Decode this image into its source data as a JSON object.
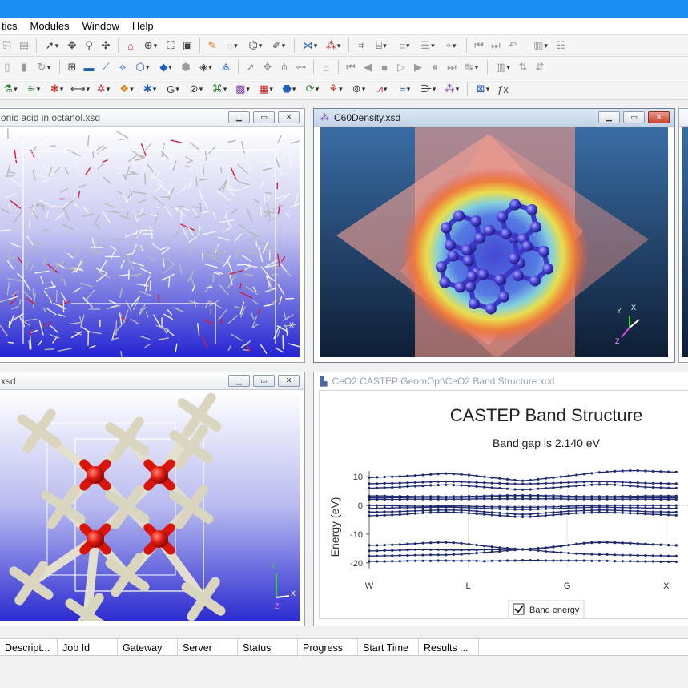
{
  "menu": [
    "tics",
    "Modules",
    "Window",
    "Help"
  ],
  "windows": {
    "octanol": {
      "title": "onic acid in octanol.xsd"
    },
    "c60": {
      "title": "C60Density.xsd"
    },
    "ceo2_struct": {
      "title": "xsd"
    },
    "band": {
      "title": "CeO2 CASTEP GeomOpt\\CeO2 Band Structure.xcd"
    }
  },
  "axis_labels": {
    "x": "X",
    "y": "Y",
    "z": "Z"
  },
  "chart_data": {
    "type": "line",
    "title": "CASTEP Band Structure",
    "subtitle": "Band gap is 2.140 eV",
    "ylabel": "Energy (eV)",
    "xlabel": "",
    "ylim": [
      -22,
      12
    ],
    "yticks": [
      10,
      0,
      -10,
      -20
    ],
    "kpoints": [
      "W",
      "L",
      "G",
      "X"
    ],
    "x": [
      0,
      1,
      2,
      3,
      4,
      5,
      6,
      7,
      8,
      9,
      10,
      11,
      12,
      13,
      14,
      15,
      16,
      17,
      18,
      19,
      20,
      21,
      22,
      23,
      24,
      25,
      26,
      27,
      28,
      29,
      30,
      31,
      32,
      33,
      34,
      35,
      36,
      37,
      38,
      39,
      40
    ],
    "series": [
      {
        "values": [
          -19.5,
          -19.5,
          -19.5,
          -19.4,
          -19.4,
          -19.3,
          -19.3,
          -19.3,
          -19.3,
          -19.2,
          -19.2,
          -19.3,
          -19.3,
          -19.3,
          -19.3,
          -19.4,
          -19.3,
          -19.3,
          -19.2,
          -19.2,
          -19.1,
          -19.1,
          -19.1,
          -19.2,
          -19.2,
          -19.2,
          -19.2,
          -19.2,
          -19.2,
          -19.3,
          -19.3,
          -19.3,
          -19.4,
          -19.4,
          -19.4,
          -19.5,
          -19.5,
          -19.5,
          -19.6,
          -19.6,
          -19.6
        ]
      },
      {
        "values": [
          -17.6,
          -17.6,
          -17.5,
          -17.5,
          -17.4,
          -17.4,
          -17.3,
          -17.3,
          -17.2,
          -17.2,
          -17.2,
          -17.1,
          -17.0,
          -16.8,
          -16.6,
          -16.4,
          -16.2,
          -16.0,
          -15.7,
          -15.5,
          -15.3,
          -15.5,
          -15.7,
          -16.0,
          -16.2,
          -16.4,
          -16.6,
          -16.8,
          -16.9,
          -17.0,
          -17.1,
          -17.1,
          -17.2,
          -17.3,
          -17.3,
          -17.4,
          -17.4,
          -17.5,
          -17.5,
          -17.6,
          -17.6
        ]
      },
      {
        "values": [
          -15.8,
          -15.8,
          -15.7,
          -15.7,
          -15.6,
          -15.5,
          -15.4,
          -15.4,
          -15.4,
          -15.4,
          -15.5,
          -15.5,
          -15.5,
          -15.5,
          -15.5,
          -15.4,
          -15.4,
          -15.4,
          -15.3,
          -15.3,
          -15.3,
          -15.2,
          -15.1,
          -14.8,
          -14.5,
          -14.2,
          -13.8,
          -13.4,
          -13.1,
          -12.9,
          -12.8,
          -12.8,
          -12.9,
          -13.0,
          -13.1,
          -13.3,
          -13.4,
          -13.6,
          -13.7,
          -13.8,
          -13.9
        ]
      },
      {
        "values": [
          -13.9,
          -13.9,
          -13.8,
          -13.7,
          -13.6,
          -13.4,
          -13.3,
          -13.1,
          -13.0,
          -12.9,
          -12.9,
          -13.0,
          -13.2,
          -13.5,
          -13.8,
          -14.1,
          -14.4,
          -14.7,
          -14.9,
          -15.1,
          -15.3,
          -15.1,
          -14.9,
          -14.7,
          -14.4,
          -14.1,
          -13.8,
          -13.5,
          -13.2,
          -13.0,
          -12.9,
          -12.9,
          -13.0,
          -13.1,
          -13.2,
          -13.3,
          -13.5,
          -13.6,
          -13.7,
          -13.8,
          -13.9
        ]
      },
      {
        "values": [
          -3.6,
          -3.5,
          -3.4,
          -3.3,
          -3.2,
          -3.0,
          -2.8,
          -2.6,
          -2.5,
          -2.4,
          -2.3,
          -2.4,
          -2.5,
          -2.7,
          -2.9,
          -3.1,
          -3.3,
          -3.5,
          -3.7,
          -3.9,
          -4.0,
          -3.9,
          -3.7,
          -3.5,
          -3.3,
          -3.1,
          -2.9,
          -2.7,
          -2.6,
          -2.5,
          -2.4,
          -2.4,
          -2.5,
          -2.6,
          -2.7,
          -2.8,
          -3.0,
          -3.1,
          -3.2,
          -3.3,
          -3.4
        ]
      },
      {
        "values": [
          -2.3,
          -2.3,
          -2.2,
          -2.2,
          -2.1,
          -2.0,
          -1.9,
          -1.8,
          -1.7,
          -1.6,
          -1.6,
          -1.6,
          -1.7,
          -1.8,
          -2.0,
          -2.2,
          -2.4,
          -2.6,
          -2.8,
          -3.0,
          -3.1,
          -3.0,
          -2.8,
          -2.6,
          -2.4,
          -2.2,
          -2.0,
          -1.9,
          -1.8,
          -1.7,
          -1.6,
          -1.6,
          -1.7,
          -1.8,
          -1.9,
          -2.0,
          -2.1,
          -2.2,
          -2.2,
          -2.3,
          -2.3
        ]
      },
      {
        "values": [
          -1.0,
          -1.0,
          -0.9,
          -0.9,
          -0.8,
          -0.8,
          -0.7,
          -0.7,
          -0.6,
          -0.6,
          -0.6,
          -0.6,
          -0.7,
          -0.8,
          -0.9,
          -1.0,
          -1.1,
          -1.2,
          -1.3,
          -1.4,
          -1.4,
          -1.4,
          -1.3,
          -1.2,
          -1.1,
          -1.0,
          -0.9,
          -0.8,
          -0.7,
          -0.6,
          -0.6,
          -0.6,
          -0.7,
          -0.7,
          -0.8,
          -0.8,
          -0.9,
          -0.9,
          -1.0,
          -1.0,
          -1.0
        ]
      },
      {
        "values": [
          0.0,
          0.0,
          -0.1,
          -0.1,
          -0.2,
          -0.2,
          -0.3,
          -0.3,
          -0.3,
          -0.2,
          -0.2,
          -0.2,
          -0.2,
          -0.3,
          -0.4,
          -0.4,
          -0.5,
          -0.5,
          -0.6,
          -0.6,
          -0.6,
          -0.6,
          -0.6,
          -0.5,
          -0.5,
          -0.4,
          -0.3,
          -0.2,
          -0.1,
          -0.1,
          0.0,
          0.0,
          0.0,
          0.0,
          0.0,
          0.0,
          0.0,
          0.0,
          0.0,
          0.0,
          0.0
        ]
      },
      {
        "values": [
          2.1,
          2.1,
          2.1,
          2.1,
          2.1,
          2.2,
          2.2,
          2.2,
          2.2,
          2.2,
          2.2,
          2.2,
          2.2,
          2.2,
          2.3,
          2.3,
          2.3,
          2.3,
          2.3,
          2.3,
          2.3,
          2.3,
          2.3,
          2.3,
          2.3,
          2.3,
          2.2,
          2.2,
          2.2,
          2.2,
          2.2,
          2.2,
          2.2,
          2.2,
          2.2,
          2.2,
          2.2,
          2.2,
          2.1,
          2.1,
          2.1
        ]
      },
      {
        "values": [
          2.6,
          2.6,
          2.6,
          2.7,
          2.7,
          2.7,
          2.8,
          2.8,
          2.8,
          2.8,
          2.8,
          2.8,
          2.8,
          2.9,
          2.9,
          2.9,
          3.0,
          3.0,
          3.0,
          3.0,
          3.0,
          3.0,
          3.0,
          3.0,
          2.9,
          2.9,
          2.9,
          2.8,
          2.8,
          2.8,
          2.8,
          2.8,
          2.8,
          2.8,
          2.7,
          2.7,
          2.7,
          2.7,
          2.6,
          2.6,
          2.6
        ]
      },
      {
        "values": [
          3.3,
          3.3,
          3.3,
          3.2,
          3.2,
          3.2,
          3.1,
          3.1,
          3.1,
          3.1,
          3.0,
          3.1,
          3.1,
          3.2,
          3.2,
          3.3,
          3.4,
          3.4,
          3.5,
          3.5,
          3.5,
          3.5,
          3.5,
          3.4,
          3.4,
          3.3,
          3.2,
          3.2,
          3.1,
          3.1,
          3.1,
          3.1,
          3.1,
          3.2,
          3.2,
          3.2,
          3.3,
          3.3,
          3.3,
          3.3,
          3.3
        ]
      },
      {
        "values": [
          6.0,
          6.1,
          6.2,
          6.3,
          6.4,
          6.6,
          6.7,
          6.8,
          7.0,
          7.1,
          7.2,
          7.1,
          7.0,
          6.8,
          6.6,
          6.4,
          6.2,
          6.0,
          5.8,
          5.6,
          5.5,
          5.6,
          5.8,
          6.0,
          6.2,
          6.4,
          6.6,
          6.8,
          7.0,
          7.2,
          7.3,
          7.3,
          7.2,
          7.0,
          6.8,
          6.6,
          6.4,
          6.3,
          6.2,
          6.1,
          6.0
        ]
      },
      {
        "values": [
          7.6,
          7.6,
          7.7,
          7.7,
          7.8,
          7.9,
          8.0,
          8.1,
          8.2,
          8.3,
          8.3,
          8.3,
          8.2,
          8.1,
          8.0,
          7.9,
          7.8,
          7.7,
          7.6,
          7.5,
          7.5,
          7.5,
          7.6,
          7.7,
          7.8,
          7.9,
          8.0,
          8.1,
          8.2,
          8.3,
          8.3,
          8.3,
          8.2,
          8.1,
          8.0,
          7.9,
          7.8,
          7.7,
          7.7,
          7.6,
          7.6
        ]
      },
      {
        "values": [
          9.7,
          9.8,
          9.9,
          10.0,
          10.1,
          10.3,
          10.4,
          10.6,
          10.8,
          11.0,
          11.1,
          11.0,
          10.8,
          10.6,
          10.3,
          10.0,
          9.7,
          9.4,
          9.1,
          8.8,
          8.6,
          8.8,
          9.1,
          9.4,
          9.7,
          10.0,
          10.3,
          10.6,
          10.9,
          11.2,
          11.5,
          11.7,
          11.9,
          12.0,
          12.1,
          12.1,
          12.0,
          11.9,
          11.8,
          11.7,
          11.6
        ]
      }
    ],
    "legend": [
      {
        "label": "Band energy",
        "checked": true
      }
    ]
  },
  "jobs_columns": [
    "Descript...",
    "Job Id",
    "Gateway",
    "Server",
    "Status",
    "Progress",
    "Start Time",
    "Results ..."
  ]
}
